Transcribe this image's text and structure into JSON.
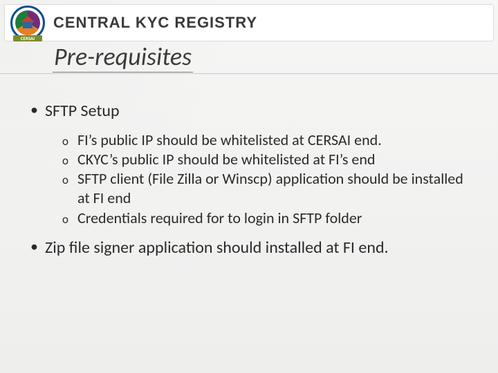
{
  "header": {
    "logo_tag": "CERSAI",
    "title": "CENTRAL KYC REGISTRY"
  },
  "page": {
    "title": "Pre-requisites"
  },
  "bullets": {
    "b1_label": "SFTP Setup",
    "b1_sub": [
      "FI’s public IP should be whitelisted at CERSAI end.",
      "CKYC’s public IP should  be whitelisted at FI’s end",
      "SFTP client (File Zilla or Winscp) application should be installed at FI end",
      "Credentials required for to login in SFTP folder"
    ],
    "b2_label": "Zip file signer application should installed at FI end."
  }
}
